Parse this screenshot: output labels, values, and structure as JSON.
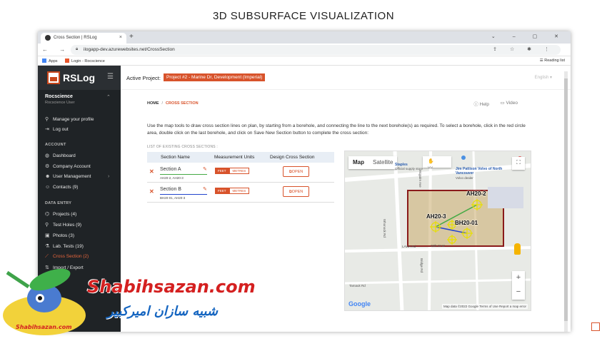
{
  "slide_title": "3D SUBSURFACE VISUALIZATION",
  "browser": {
    "tab_title": "Cross Section | RSLog",
    "tab_close": "×",
    "new_tab": "+",
    "window_controls": "⌄ – ▢ ✕",
    "nav_icons": "← → ↻",
    "url": "ilogapp-dev.azurewebsites.net/CrossSection",
    "omni_icons": "⇪ ☆ ✱ ⋮",
    "bookmarks": [
      "Apps",
      "Login - Rocscience"
    ],
    "reading_list": "Reading list"
  },
  "sidebar": {
    "logo": "RSLog",
    "user_name": "Rocscience",
    "user_role": "Rocscience User",
    "user_items": [
      {
        "label": "Manage your profile",
        "icon": "user-icon"
      },
      {
        "label": "Log out",
        "icon": "logout-icon"
      }
    ],
    "account_heading": "ACCOUNT",
    "account_items": [
      {
        "label": "Dashboard",
        "icon": "dashboard-icon"
      },
      {
        "label": "Company Account",
        "icon": "gear-icon"
      },
      {
        "label": "User Management",
        "icon": "users-icon"
      },
      {
        "label": "Contacts (9)",
        "icon": "contacts-icon"
      }
    ],
    "data_heading": "DATA ENTRY",
    "data_items": [
      {
        "label": "Projects (4)",
        "icon": "projects-icon"
      },
      {
        "label": "Test Holes (9)",
        "icon": "pin-icon"
      },
      {
        "label": "Photos (3)",
        "icon": "photo-icon"
      },
      {
        "label": "Lab. Tests (19)",
        "icon": "lab-icon"
      },
      {
        "label": "Cross Section (2)",
        "icon": "cross-section-icon"
      },
      {
        "label": "Import / Export",
        "icon": "import-icon"
      }
    ]
  },
  "header": {
    "active_project_label": "Active Project:",
    "active_project": "Project #2 - Marine Dr, Development (Imperial)",
    "language": "English ▾"
  },
  "breadcrumb": {
    "home": "HOME",
    "sep": "/",
    "current": "CROSS SECTION"
  },
  "help_label": "Help",
  "video_label": "Video",
  "instructions": "Use the map tools to draw cross section lines on plan, by starting from a borehole, and connecting the line to the next borehole(s) as required. To select a borehole, click in the red circle area, double click on the last borehole, and click on Save New Section button to complete the cross section:",
  "list_label": "LIST OF EXISTING CROSS SECTIONS :",
  "table": {
    "headers": [
      "Section Name",
      "Measurement Units",
      "Design Cross Section"
    ],
    "rows": [
      {
        "name": "Section A",
        "boreholes": "AH20-2, AH20-3",
        "unit_on": "FEET",
        "unit_off": "METRES",
        "action": "OPEN",
        "line_color": "#44aa44"
      },
      {
        "name": "Section B",
        "boreholes": "BH20-01, AH20-3",
        "unit_on": "FEET",
        "unit_off": "METRES",
        "action": "OPEN",
        "line_color": "#2244cc"
      }
    ]
  },
  "map": {
    "type_map": "Map",
    "type_satellite": "Satellite",
    "poi_volvo": "Jim Pattison Volvo of North Vancouver",
    "poi_volvo_sub": "Volvo dealer",
    "poi_staples": "Staples",
    "poi_staples_sub": "Official supply store",
    "roads": [
      "Marine Dr",
      "Whonock Rd",
      "LAWA Rd",
      "15th St W",
      "Mcguire Ave",
      "Bridge Rd",
      "Tamauk Rd"
    ],
    "boreholes": [
      "AH20-2",
      "AH20-3",
      "BH20-01"
    ],
    "google": "Google",
    "footer": "Map data ©2022 Google   Terms of Use   Report a map error"
  },
  "watermark": {
    "brand": "Shabihsazan.com",
    "small": "Shabihsazan.com",
    "fa": "شبیه سازان امیرکبیر"
  },
  "colors": {
    "accent": "#d8532b",
    "sidebar": "#1f2326",
    "section_a": "#44aa44",
    "section_b": "#2244cc",
    "parcel": "#8a1a1a"
  }
}
